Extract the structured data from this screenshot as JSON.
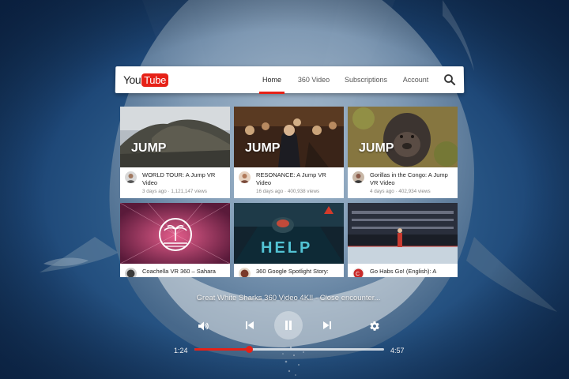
{
  "header": {
    "logo_you": "You",
    "logo_tube": "Tube",
    "tabs": [
      {
        "label": "Home",
        "active": true
      },
      {
        "label": "360 Video",
        "active": false
      },
      {
        "label": "Subscriptions",
        "active": false
      },
      {
        "label": "Account",
        "active": false
      }
    ],
    "search_icon": "search-icon"
  },
  "videos": [
    {
      "title": "WORLD TOUR: A Jump VR Video",
      "meta": "3 days ago · 1,121,147 views",
      "overlay": "JUMP"
    },
    {
      "title": "RESONANCE: A Jump VR Video",
      "meta": "16 days ago · 400,938 views",
      "overlay": "JUMP"
    },
    {
      "title": "Gorillas in the Congo: A Jump VR Video",
      "meta": "4 days ago · 402,934 views",
      "overlay": "JUMP"
    },
    {
      "title": "Coachella VR 360 – Sahara",
      "meta": ""
    },
    {
      "title": "360 Google Spotlight Story:",
      "meta": "",
      "overlay": "HELP"
    },
    {
      "title": "Go Habs Go! (English): A",
      "meta": ""
    }
  ],
  "player": {
    "now_playing": "Great White Sharks 360 Video 4K!! - Close encounter...",
    "current_time": "1:24",
    "total_time": "4:57",
    "progress_fraction": 0.29,
    "icons": [
      "volume-icon",
      "previous-icon",
      "pause-icon",
      "next-icon",
      "settings-icon"
    ]
  },
  "colors": {
    "accent": "#e62117",
    "background": "#2f5f8e",
    "card_bg": "#ffffff"
  }
}
